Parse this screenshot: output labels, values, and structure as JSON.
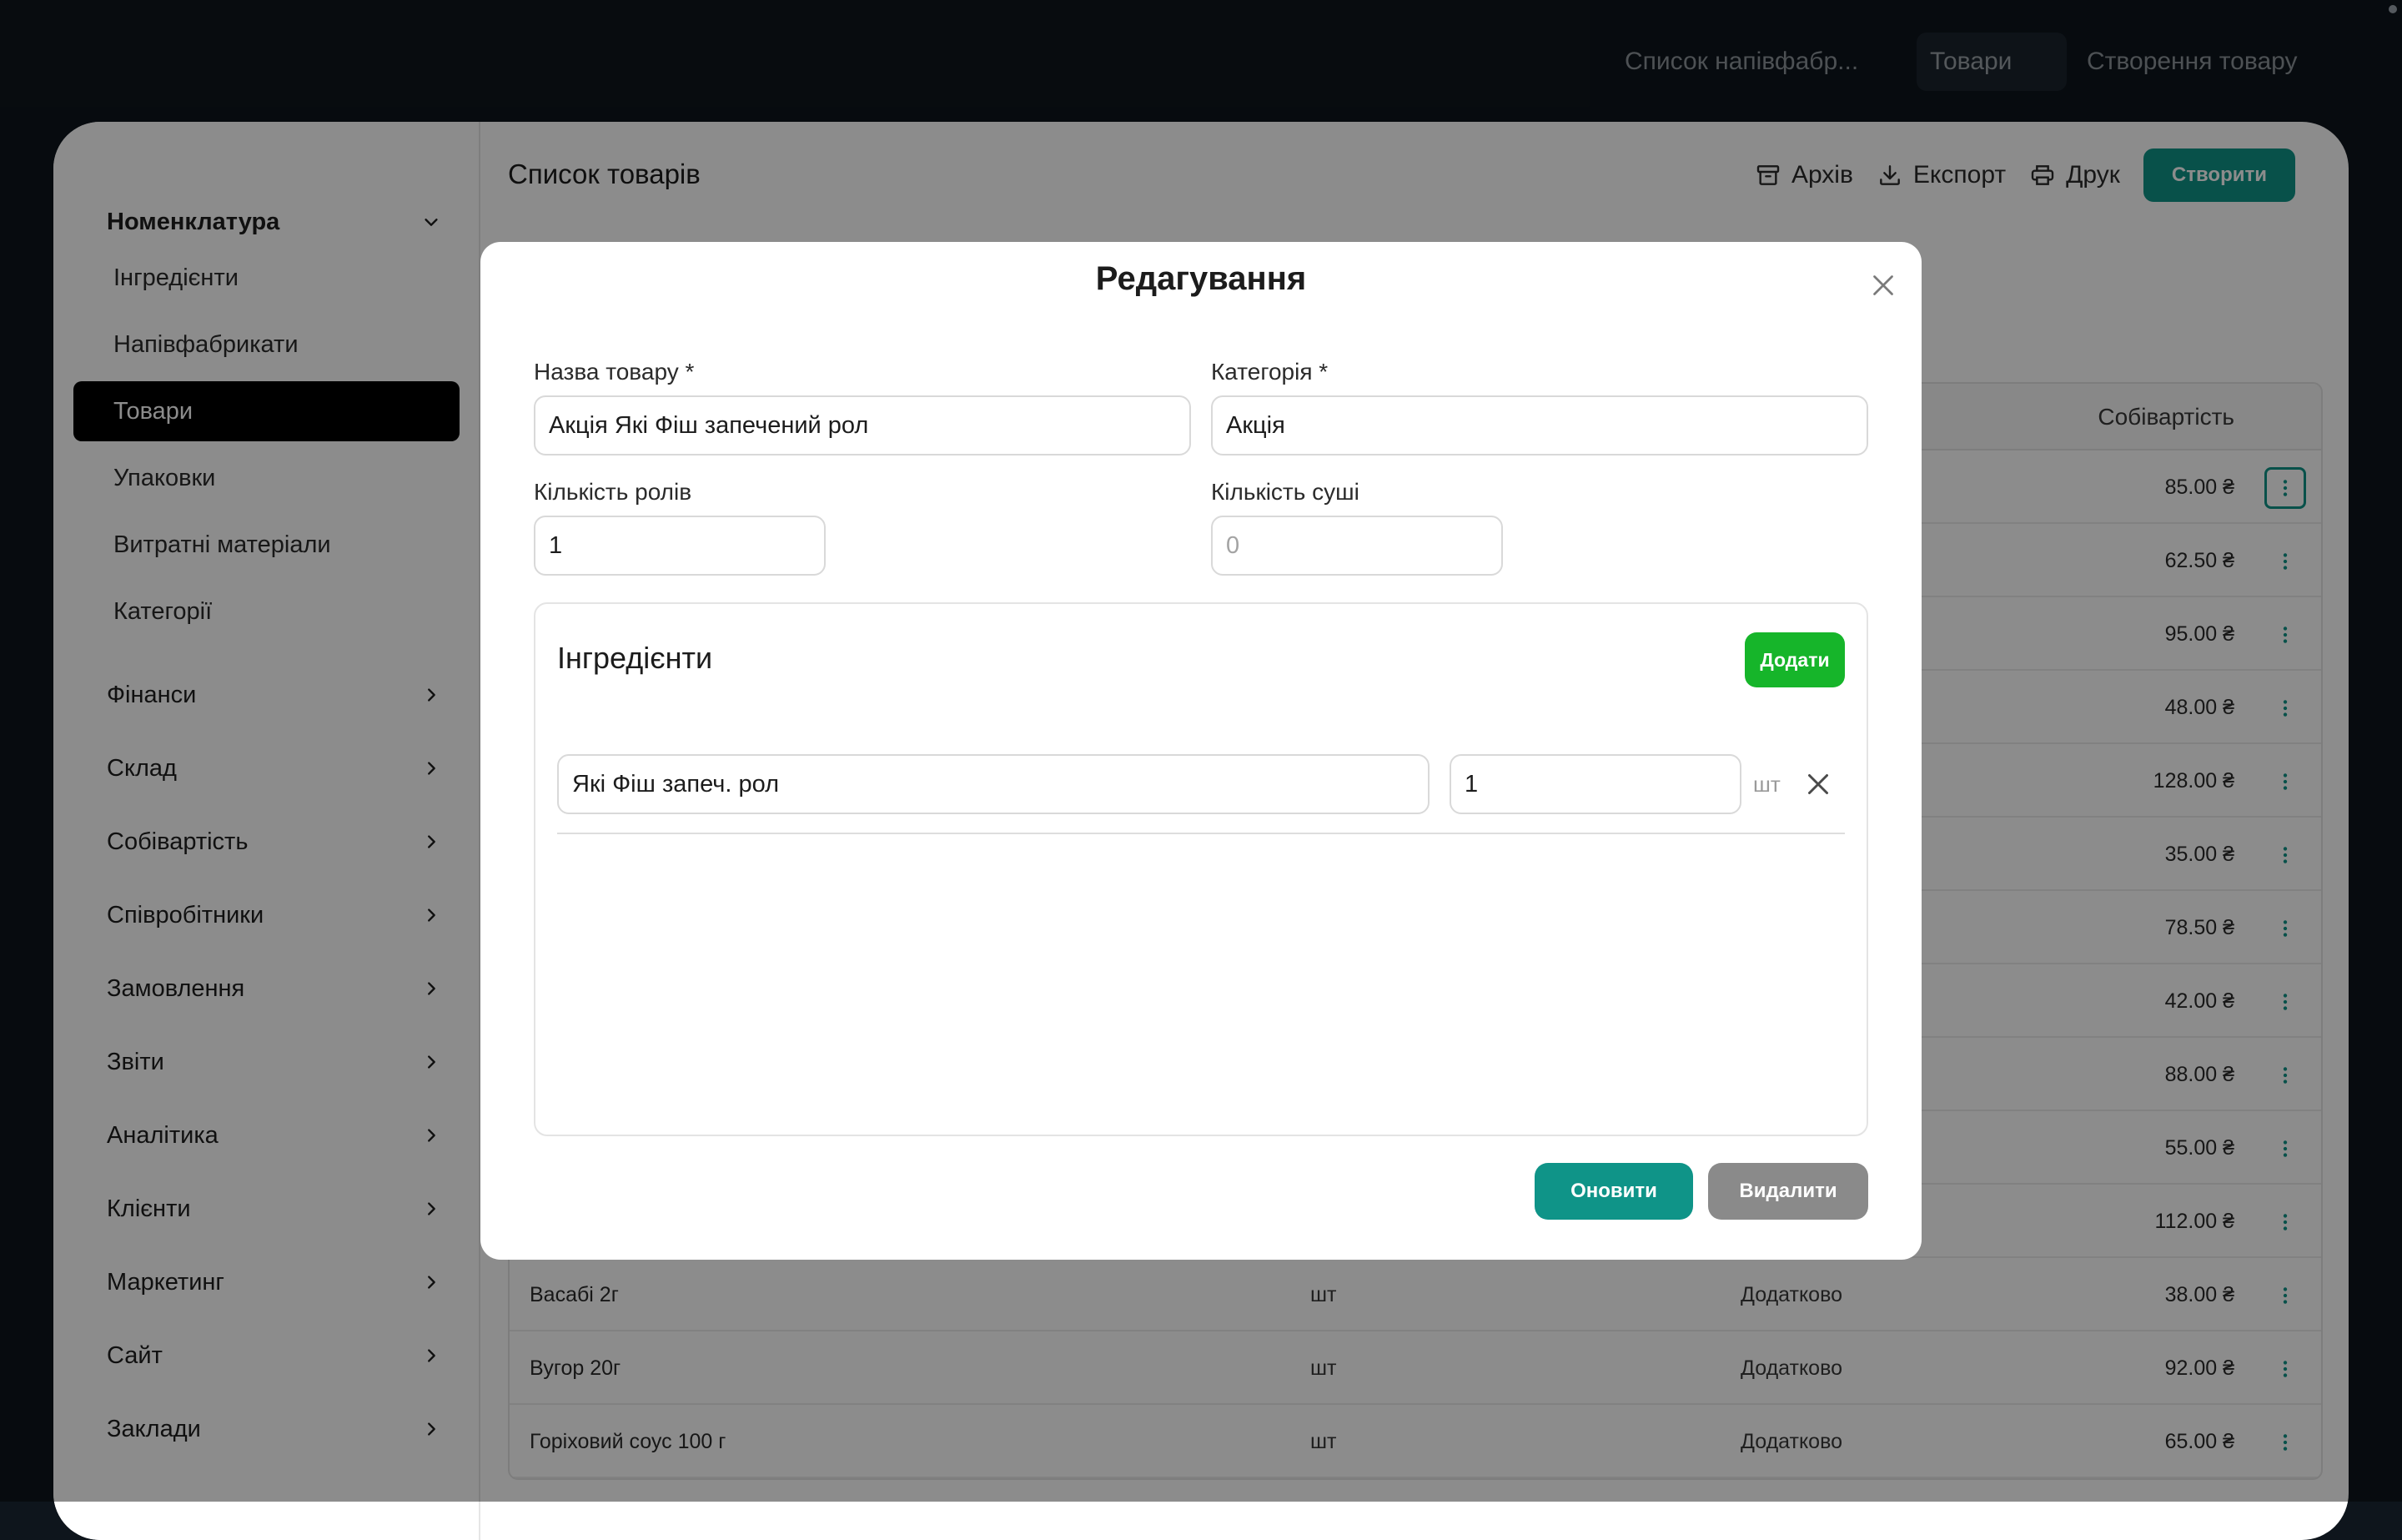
{
  "topnav": {
    "tabs": [
      {
        "label": "Список напівфабр..."
      },
      {
        "label": "Товари",
        "active": true
      },
      {
        "label": "Створення товару"
      }
    ]
  },
  "sidebar": {
    "nomenclature": {
      "label": "Номенклатура",
      "items": [
        {
          "label": "Інгредієнти"
        },
        {
          "label": "Напівфабрикати"
        },
        {
          "label": "Товари",
          "active": true
        },
        {
          "label": "Упаковки"
        },
        {
          "label": "Витратні матеріали"
        },
        {
          "label": "Категорії"
        }
      ]
    },
    "groups": [
      {
        "label": "Фінанси"
      },
      {
        "label": "Склад"
      },
      {
        "label": "Собівартість"
      },
      {
        "label": "Співробітники"
      },
      {
        "label": "Замовлення"
      },
      {
        "label": "Звіти"
      },
      {
        "label": "Аналітика"
      },
      {
        "label": "Клієнти"
      },
      {
        "label": "Маркетинг"
      },
      {
        "label": "Сайт"
      },
      {
        "label": "Заклади"
      }
    ]
  },
  "main": {
    "title": "Список товарів",
    "toolbar": {
      "archive": "Архів",
      "export": "Експорт",
      "print": "Друк",
      "create": "Створити"
    },
    "table": {
      "cost_header": "Собівартість",
      "rows": [
        {
          "name": "",
          "unit": "",
          "category": "",
          "cost": "85.00 ₴"
        },
        {
          "name": "",
          "unit": "",
          "category": "",
          "cost": "62.50 ₴"
        },
        {
          "name": "",
          "unit": "",
          "category": "",
          "cost": "95.00 ₴"
        },
        {
          "name": "",
          "unit": "",
          "category": "",
          "cost": "48.00 ₴"
        },
        {
          "name": "",
          "unit": "",
          "category": "",
          "cost": "128.00 ₴"
        },
        {
          "name": "",
          "unit": "",
          "category": "",
          "cost": "35.00 ₴"
        },
        {
          "name": "",
          "unit": "",
          "category": "",
          "cost": "78.50 ₴"
        },
        {
          "name": "",
          "unit": "",
          "category": "",
          "cost": "42.00 ₴"
        },
        {
          "name": "",
          "unit": "",
          "category": "",
          "cost": "88.00 ₴"
        },
        {
          "name": "",
          "unit": "",
          "category": "",
          "cost": "55.00 ₴"
        },
        {
          "name": "",
          "unit": "",
          "category": "",
          "cost": "112.00 ₴"
        },
        {
          "name": "Васабі 2г",
          "unit": "шт",
          "category": "Додатково",
          "cost": "38.00 ₴"
        },
        {
          "name": "Вугор 20г",
          "unit": "шт",
          "category": "Додатково",
          "cost": "92.00 ₴"
        },
        {
          "name": "Горіховий соус 100 г",
          "unit": "шт",
          "category": "Додатково",
          "cost": "65.00 ₴"
        }
      ]
    }
  },
  "modal": {
    "title": "Редагування",
    "name_label": "Назва товару *",
    "name_value": "Акція Які Фіш запечений рол",
    "category_label": "Категорія *",
    "category_value": "Акція",
    "rolls_label": "Кількість ролів",
    "rolls_value": "1",
    "sushi_label": "Кількість суші",
    "sushi_placeholder": "0",
    "ingredients": {
      "title": "Інгредієнти",
      "add_label": "Додати",
      "items": [
        {
          "name": "Які Фіш запеч. рол",
          "qty": "1",
          "unit": "шт"
        }
      ]
    },
    "update_label": "Оновити",
    "delete_label": "Видалити"
  },
  "colors": {
    "accent": "#0f9488",
    "add_green": "#16b52a",
    "delete_gray": "#8a8a8a",
    "background": "#0e151c"
  }
}
